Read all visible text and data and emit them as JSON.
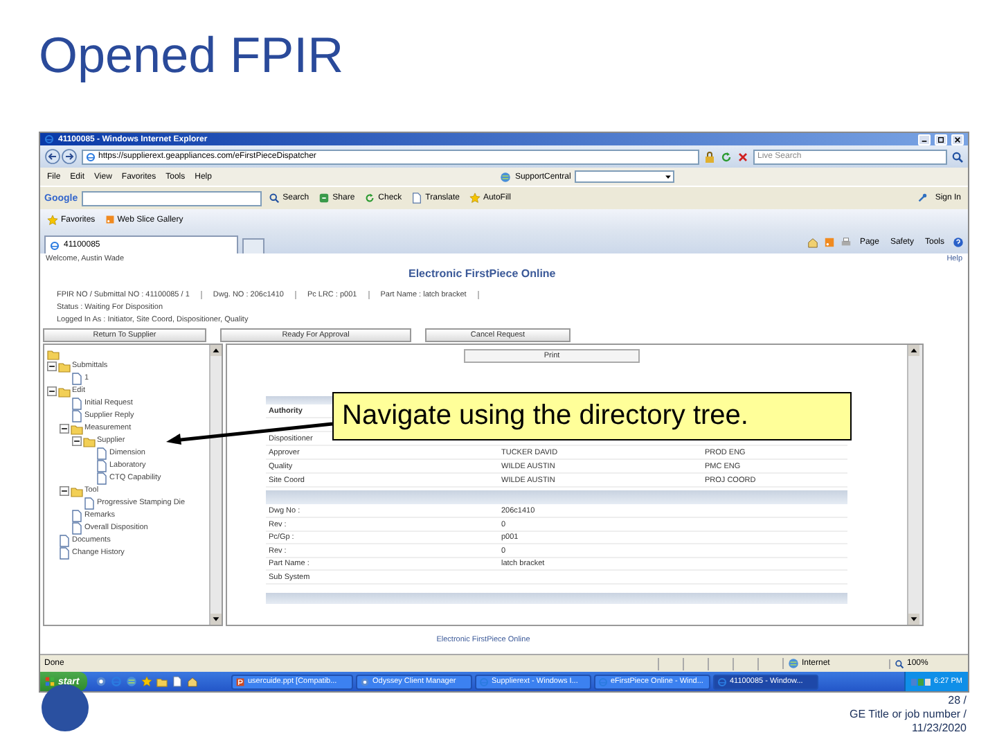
{
  "slide": {
    "title": "Opened FPIR",
    "callout": "Navigate using the directory tree.",
    "page_number": "28 /",
    "footer_title": "GE Title or job number /",
    "date": "11/23/2020"
  },
  "browser": {
    "title": "41100085 - Windows Internet Explorer",
    "address": "https://supplierext.geappliances.com/eFirstPieceDispatcher",
    "search_placeholder": "Live Search",
    "menu": [
      "File",
      "Edit",
      "View",
      "Favorites",
      "Tools",
      "Help"
    ],
    "support_central": "SupportCentral",
    "google_label": "Google",
    "google_buttons": [
      "Search",
      "Share",
      "Check",
      "Translate",
      "AutoFill"
    ],
    "sign_in": "Sign In",
    "favorites": "Favorites",
    "web_slice": "Web Slice Gallery",
    "tabs": [
      {
        "label": "41100085",
        "selected": true
      }
    ],
    "commands": [
      "Page",
      "Safety",
      "Tools"
    ],
    "status": {
      "text": "Done",
      "zone": "Internet",
      "zoom": "100%"
    }
  },
  "app": {
    "welcome": "Welcome, Austin Wade",
    "help": "Help",
    "title": "Electronic FirstPiece Online",
    "info": [
      "FPIR NO / Submittal NO : 41100085 / 1",
      "Dwg. NO : 206c1410",
      "Pc LRC : p001",
      "Part Name : latch bracket"
    ],
    "status": "Status : Waiting For Disposition",
    "logged_in": "Logged In As : Initiator, Site Coord, Dispositioner, Quality",
    "actions": [
      "Return To Supplier",
      "Ready For Approval",
      "Cancel Request"
    ],
    "print": "Print",
    "tree": [
      {
        "label": "Submittals",
        "kind": "folder",
        "expanded": true,
        "children": [
          {
            "label": "1",
            "kind": "page"
          }
        ]
      },
      {
        "label": "Edit",
        "kind": "folder",
        "expanded": true,
        "children": [
          {
            "label": "Initial Request",
            "kind": "page"
          },
          {
            "label": "Supplier Reply",
            "kind": "page"
          },
          {
            "label": "Measurement",
            "kind": "folder",
            "expanded": true,
            "children": [
              {
                "label": "Supplier",
                "kind": "folder",
                "expanded": true,
                "children": [
                  {
                    "label": "Dimension",
                    "kind": "page"
                  },
                  {
                    "label": "Laboratory",
                    "kind": "page"
                  },
                  {
                    "label": "CTQ Capability",
                    "kind": "page"
                  }
                ]
              }
            ]
          },
          {
            "label": "Tool",
            "kind": "folder",
            "expanded": true,
            "children": [
              {
                "label": "Progressive Stamping Die",
                "kind": "page"
              }
            ]
          },
          {
            "label": "Remarks",
            "kind": "page"
          },
          {
            "label": "Overall Disposition",
            "kind": "page"
          }
        ]
      },
      {
        "label": "Documents",
        "kind": "page"
      },
      {
        "label": "Change History",
        "kind": "page"
      }
    ],
    "authority_rows": [
      {
        "label": "Authority"
      },
      {
        "label": "Dispositioner"
      },
      {
        "label": "Approver",
        "name": "TUCKER DAVID",
        "role": "PROD ENG"
      },
      {
        "label": "Quality",
        "name": "WILDE AUSTIN",
        "role": "PMC ENG"
      },
      {
        "label": "Site Coord",
        "name": "WILDE AUSTIN",
        "role": "PROJ COORD"
      }
    ],
    "drawing_rows": [
      {
        "label": "Dwg No :",
        "value": "206c1410"
      },
      {
        "label": "Rev :",
        "value": "0"
      },
      {
        "label": "Pc/Gp :",
        "value": "p001"
      },
      {
        "label": "Rev :",
        "value": "0"
      },
      {
        "label": "Part Name :",
        "value": "latch bracket"
      },
      {
        "label": "Sub System"
      }
    ],
    "footer": "Electronic FirstPiece Online"
  },
  "taskbar": {
    "start": "start",
    "items": [
      {
        "label": "usercuide.ppt [Compatib...",
        "kind": "ppt",
        "selected": false
      },
      {
        "label": "Odyssey Client Manager",
        "kind": "web",
        "selected": false
      },
      {
        "label": "Supplierext - Windows I...",
        "kind": "ie",
        "selected": false
      },
      {
        "label": "eFirstPiece Online - Wind...",
        "kind": "ie",
        "selected": false
      },
      {
        "label": "41100085 - Window...",
        "kind": "ie",
        "selected": true
      }
    ],
    "clock": "6:27 PM"
  }
}
